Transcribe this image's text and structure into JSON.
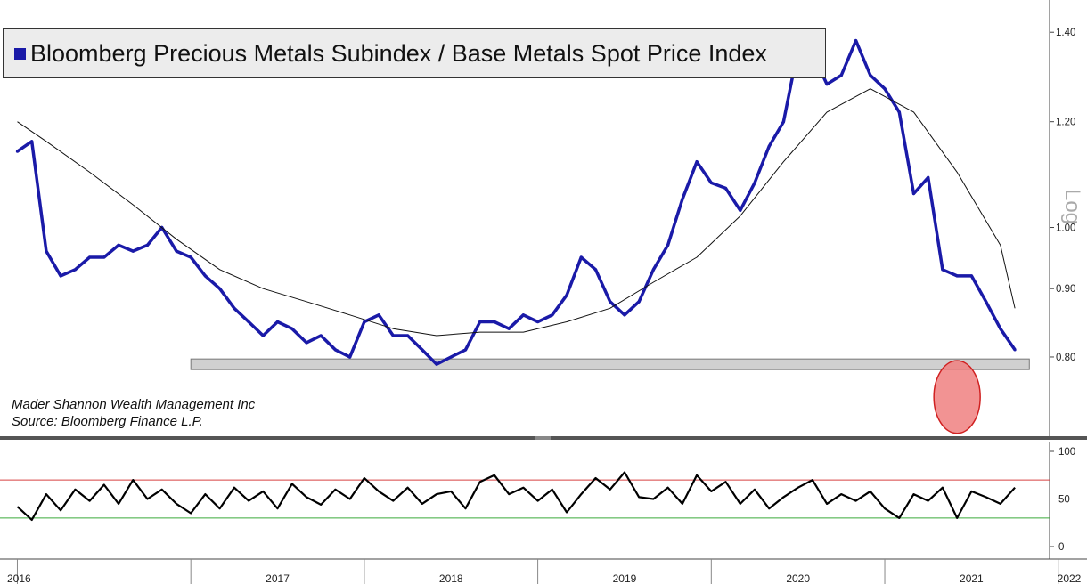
{
  "legend": {
    "label": "Bloomberg Precious Metals Subindex / Base Metals Spot Price Index",
    "color": "#1a1aa8"
  },
  "credits": {
    "line1": "Mader Shannon Wealth Management Inc",
    "line2": "Source: Bloomberg Finance L.P."
  },
  "axis_scale_label": "Log",
  "colors": {
    "ratio": "#1a1aa8",
    "ma": "#111111",
    "rsi": "#000000",
    "overbought": "#d64040",
    "oversold": "#3aaa3a",
    "support_band": "#d0d0d0",
    "highlight": "#f08080"
  },
  "chart_data": [
    {
      "type": "line",
      "title": "Bloomberg Precious Metals Subindex / Base Metals Spot Price Index",
      "scale": "log",
      "ylim": [
        0.7,
        1.48
      ],
      "yticks": [
        "0.80",
        "0.90",
        "1.00",
        "1.20",
        "1.40"
      ],
      "xlim": [
        "2016-01",
        "2021-12"
      ],
      "xticks": [
        "2016",
        "2017",
        "2018",
        "2019",
        "2020",
        "2021",
        "2022"
      ],
      "series": [
        {
          "name": "Bloomberg Precious Metals Subindex / Base Metals Spot Price Index",
          "x": [
            "2016-01",
            "2016-02",
            "2016-03",
            "2016-04",
            "2016-05",
            "2016-06",
            "2016-07",
            "2016-08",
            "2016-09",
            "2016-10",
            "2016-11",
            "2016-12",
            "2017-01",
            "2017-02",
            "2017-03",
            "2017-04",
            "2017-05",
            "2017-06",
            "2017-07",
            "2017-08",
            "2017-09",
            "2017-10",
            "2017-11",
            "2017-12",
            "2018-01",
            "2018-02",
            "2018-03",
            "2018-04",
            "2018-05",
            "2018-06",
            "2018-07",
            "2018-08",
            "2018-09",
            "2018-10",
            "2018-11",
            "2018-12",
            "2019-01",
            "2019-02",
            "2019-03",
            "2019-04",
            "2019-05",
            "2019-06",
            "2019-07",
            "2019-08",
            "2019-09",
            "2019-10",
            "2019-11",
            "2019-12",
            "2020-01",
            "2020-02",
            "2020-03",
            "2020-04",
            "2020-05",
            "2020-06",
            "2020-07",
            "2020-08",
            "2020-09",
            "2020-10",
            "2020-11",
            "2020-12",
            "2021-01",
            "2021-02",
            "2021-03",
            "2021-04",
            "2021-05",
            "2021-06",
            "2021-07",
            "2021-08",
            "2021-09",
            "2021-10"
          ],
          "values": [
            1.14,
            1.16,
            0.96,
            0.92,
            0.93,
            0.95,
            0.95,
            0.97,
            0.96,
            0.97,
            1.0,
            0.96,
            0.95,
            0.92,
            0.9,
            0.87,
            0.85,
            0.83,
            0.85,
            0.84,
            0.82,
            0.83,
            0.81,
            0.8,
            0.85,
            0.86,
            0.83,
            0.83,
            0.81,
            0.79,
            0.8,
            0.81,
            0.85,
            0.85,
            0.84,
            0.86,
            0.85,
            0.86,
            0.89,
            0.95,
            0.93,
            0.88,
            0.86,
            0.88,
            0.93,
            0.97,
            1.05,
            1.12,
            1.08,
            1.07,
            1.03,
            1.08,
            1.15,
            1.2,
            1.36,
            1.35,
            1.28,
            1.3,
            1.38,
            1.3,
            1.27,
            1.22,
            1.06,
            1.09,
            0.93,
            0.92,
            0.92,
            0.88,
            0.84,
            0.81
          ]
        },
        {
          "name": "",
          "x": [
            "2016-01",
            "2016-03",
            "2016-06",
            "2016-09",
            "2016-12",
            "2017-03",
            "2017-06",
            "2017-09",
            "2017-12",
            "2018-03",
            "2018-06",
            "2018-09",
            "2018-12",
            "2019-03",
            "2019-06",
            "2019-09",
            "2019-12",
            "2020-03",
            "2020-06",
            "2020-09",
            "2020-12",
            "2021-03",
            "2021-06",
            "2021-09",
            "2021-10"
          ],
          "values": [
            1.2,
            1.16,
            1.1,
            1.04,
            0.98,
            0.93,
            0.9,
            0.88,
            0.86,
            0.84,
            0.83,
            0.835,
            0.835,
            0.85,
            0.87,
            0.91,
            0.95,
            1.02,
            1.12,
            1.22,
            1.27,
            1.22,
            1.1,
            0.97,
            0.87
          ]
        }
      ],
      "annotations": [
        {
          "type": "support_band",
          "from": "2017-01",
          "to": "2021-11",
          "value": 0.79
        },
        {
          "type": "highlight_circle",
          "x": "2021-06",
          "low": 0.71
        }
      ]
    },
    {
      "type": "line",
      "ylim": [
        0,
        100
      ],
      "yticks": [
        "0",
        "50",
        "100"
      ],
      "reference_lines": [
        70,
        30
      ],
      "series": [
        {
          "name": "",
          "x": [
            "2016-01",
            "2016-02",
            "2016-03",
            "2016-04",
            "2016-05",
            "2016-06",
            "2016-07",
            "2016-08",
            "2016-09",
            "2016-10",
            "2016-11",
            "2016-12",
            "2017-01",
            "2017-02",
            "2017-03",
            "2017-04",
            "2017-05",
            "2017-06",
            "2017-07",
            "2017-08",
            "2017-09",
            "2017-10",
            "2017-11",
            "2017-12",
            "2018-01",
            "2018-02",
            "2018-03",
            "2018-04",
            "2018-05",
            "2018-06",
            "2018-07",
            "2018-08",
            "2018-09",
            "2018-10",
            "2018-11",
            "2018-12",
            "2019-01",
            "2019-02",
            "2019-03",
            "2019-04",
            "2019-05",
            "2019-06",
            "2019-07",
            "2019-08",
            "2019-09",
            "2019-10",
            "2019-11",
            "2019-12",
            "2020-01",
            "2020-02",
            "2020-03",
            "2020-04",
            "2020-05",
            "2020-06",
            "2020-07",
            "2020-08",
            "2020-09",
            "2020-10",
            "2020-11",
            "2020-12",
            "2021-01",
            "2021-02",
            "2021-03",
            "2021-04",
            "2021-05",
            "2021-06",
            "2021-07",
            "2021-08",
            "2021-09",
            "2021-10"
          ],
          "values": [
            42,
            28,
            55,
            38,
            60,
            48,
            65,
            45,
            70,
            50,
            60,
            45,
            35,
            55,
            40,
            62,
            48,
            58,
            40,
            66,
            52,
            44,
            60,
            50,
            72,
            58,
            48,
            62,
            45,
            55,
            58,
            40,
            68,
            75,
            55,
            62,
            48,
            60,
            36,
            55,
            72,
            60,
            78,
            52,
            50,
            62,
            45,
            75,
            58,
            68,
            45,
            60,
            40,
            52,
            62,
            70,
            45,
            55,
            48,
            58,
            40,
            30,
            55,
            48,
            62,
            30,
            58,
            52,
            45,
            62
          ]
        }
      ]
    }
  ]
}
